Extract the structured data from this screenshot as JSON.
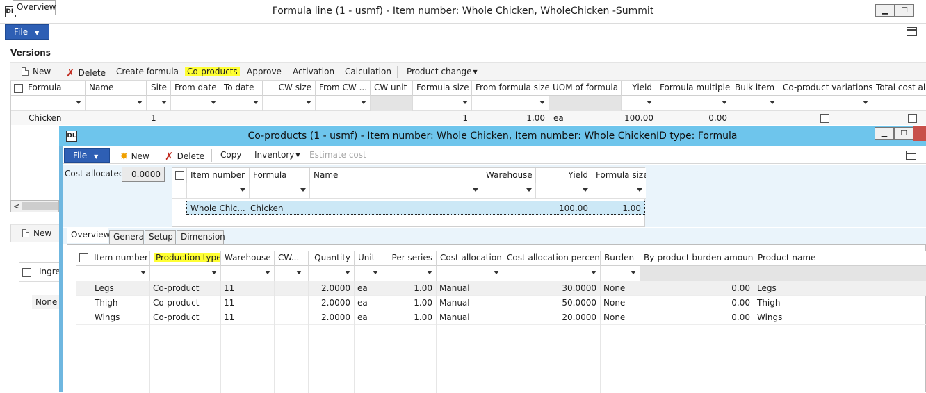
{
  "outer": {
    "title": "Formula line (1 - usmf) - Item number: Whole Chicken, WholeChicken -Summit",
    "app_icon_text": "DL",
    "file_label": "File",
    "versions_label": "Versions",
    "toolbar": {
      "new": "New",
      "delete": "Delete",
      "create_formula": "Create formula",
      "co_products": "Co-products",
      "approve": "Approve",
      "activation": "Activation",
      "calculation": "Calculation",
      "product_change": "Product change"
    },
    "grid": {
      "columns": [
        "Formula",
        "Name",
        "Site",
        "From date",
        "To date",
        "CW size",
        "From CW ...",
        "CW unit",
        "Formula size",
        "From formula size",
        "UOM of formula",
        "Yield",
        "Formula multiple",
        "Bulk item",
        "Co-product variations",
        "Total cost all"
      ],
      "row": {
        "formula": "Chicken",
        "site": "1",
        "formula_size": "1",
        "from_formula_size": "1.00",
        "uom": "ea",
        "yield": "100.00",
        "formula_multiple": "0.00"
      }
    },
    "lower": {
      "new": "New",
      "tab_overview": "Overview",
      "col_ingredient": "Ingred",
      "row_value": "None",
      "scroll_left": "<"
    }
  },
  "co": {
    "title": "Co-products (1 - usmf) - Item number: Whole Chicken, Item number: Whole ChickenID type: Formula",
    "app_icon_text": "DL",
    "file_label": "File",
    "toolbar": {
      "new": "New",
      "delete": "Delete",
      "copy": "Copy",
      "inventory": "Inventory",
      "estimate_cost": "Estimate cost"
    },
    "cost_allocated_label": "Cost allocated:",
    "cost_allocated_value": "0.0000",
    "top_grid": {
      "columns": [
        "Item number",
        "Formula",
        "Name",
        "Warehouse",
        "Yield",
        "Formula size"
      ],
      "row": {
        "item": "Whole Chic...",
        "formula": "Chicken",
        "yield": "100.00",
        "formula_size": "1.00"
      }
    },
    "tabs": [
      "Overview",
      "General",
      "Setup",
      "Dimension"
    ],
    "lines": {
      "columns": [
        "Item number",
        "Production type",
        "Warehouse",
        "CW...",
        "Quantity",
        "Unit",
        "Per series",
        "Cost allocation",
        "Cost allocation percent",
        "Burden",
        "By-product burden amount",
        "Product name"
      ],
      "rows": [
        [
          "Legs",
          "Co-product",
          "11",
          "",
          "2.0000",
          "ea",
          "1.00",
          "Manual",
          "30.0000",
          "None",
          "0.00",
          "Legs"
        ],
        [
          "Thigh",
          "Co-product",
          "11",
          "",
          "2.0000",
          "ea",
          "1.00",
          "Manual",
          "50.0000",
          "None",
          "0.00",
          "Thigh"
        ],
        [
          "Wings",
          "Co-product",
          "11",
          "",
          "2.0000",
          "ea",
          "1.00",
          "Manual",
          "20.0000",
          "None",
          "0.00",
          "Wings"
        ]
      ]
    }
  },
  "icons": {
    "minimize": "▁",
    "maximize": "☐",
    "caret": "▼",
    "delete_x": "✗",
    "new_star": "✸"
  },
  "colors": {
    "file_button": "#2e5fb4",
    "co_titlebar": "#6ec5ec",
    "highlight": "#ffff33",
    "selected_row": "#cce8f6",
    "close_button": "#c8504a"
  }
}
